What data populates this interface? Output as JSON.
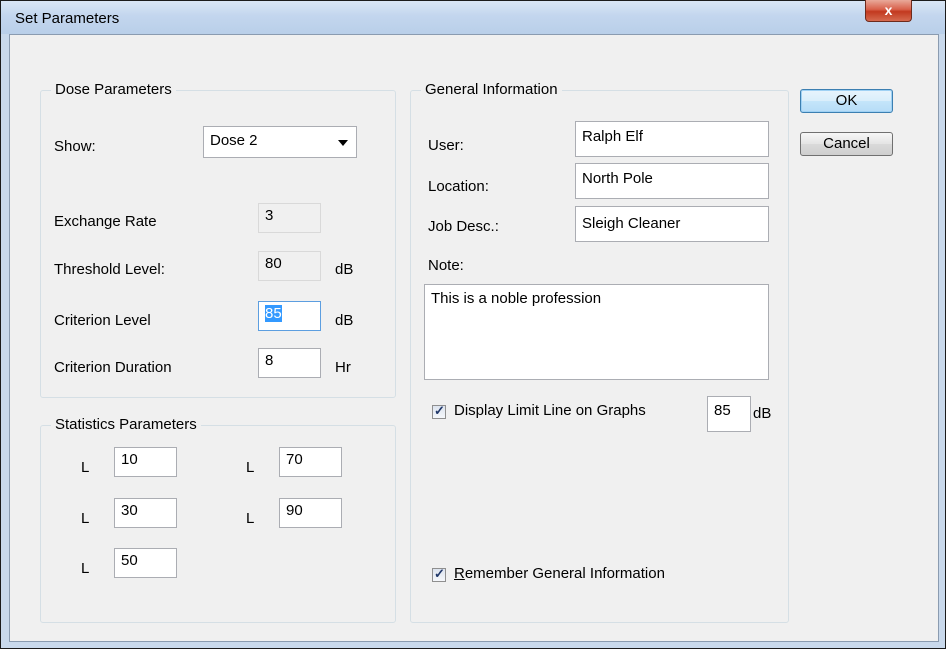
{
  "window": {
    "title": "Set Parameters",
    "close_glyph": "x"
  },
  "buttons": {
    "ok": "OK",
    "cancel": "Cancel"
  },
  "dose": {
    "title": "Dose Parameters",
    "show_label": "Show:",
    "show_value": "Dose 2",
    "exchange_label": "Exchange Rate",
    "exchange_value": "3",
    "threshold_label": "Threshold Level:",
    "threshold_value": "80",
    "threshold_unit": "dB",
    "criterion_label": "Criterion Level",
    "criterion_value": "85",
    "criterion_unit": "dB",
    "duration_label": "Criterion Duration",
    "duration_value": "8",
    "duration_unit": "Hr"
  },
  "stats": {
    "title": "Statistics Parameters",
    "prefix": "L",
    "l1": "10",
    "l2": "70",
    "l3": "30",
    "l4": "90",
    "l5": "50"
  },
  "general": {
    "title": "General Information",
    "user_label": "User:",
    "user_value": "Ralph Elf",
    "location_label": "Location:",
    "location_value": "North Pole",
    "job_label": "Job Desc.:",
    "job_value": "Sleigh Cleaner",
    "note_label": "Note:",
    "note_value": "This is a noble profession",
    "limit_label": "Display Limit Line on Graphs",
    "limit_value": "85",
    "limit_unit": "dB",
    "limit_checked": true,
    "remember_first": "R",
    "remember_rest": "emember General Information",
    "remember_checked": true
  }
}
